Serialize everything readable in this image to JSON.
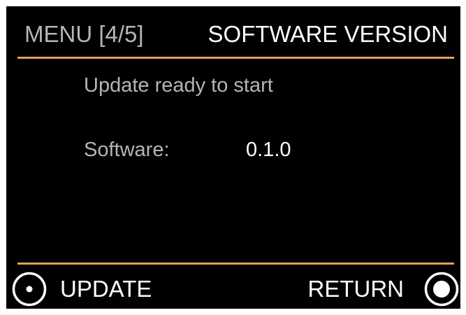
{
  "header": {
    "menu_index": "MENU [4/5]",
    "title": "SOFTWARE VERSION"
  },
  "content": {
    "status": "Update ready to start",
    "software_label": "Software:",
    "software_version": "0.1.0"
  },
  "footer": {
    "left_button": {
      "label": "UPDATE",
      "icon": "hollow-dot-ring-icon"
    },
    "right_button": {
      "label": "RETURN",
      "icon": "filled-dot-ring-icon"
    }
  },
  "colors": {
    "background": "#000000",
    "accent_line": "#e3a24e",
    "primary_text": "#ffffff",
    "secondary_text": "#b5b5b5"
  }
}
